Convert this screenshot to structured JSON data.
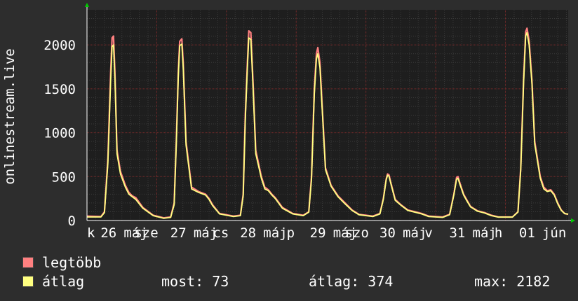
{
  "chart_data": {
    "type": "line",
    "ylabel": "onlinestream.live",
    "ylim": [
      0,
      2400
    ],
    "yticks": [
      0,
      500,
      1000,
      1500,
      2000
    ],
    "xlim": [
      0,
      6.9
    ],
    "xtick_labels": [
      {
        "x": 0.0,
        "label": "k"
      },
      {
        "x": 0.31,
        "label": "26"
      },
      {
        "x": 0.7,
        "label": "máj"
      },
      {
        "x": 0.85,
        "label": "sze"
      },
      {
        "x": 1.31,
        "label": "27"
      },
      {
        "x": 1.7,
        "label": "máj"
      },
      {
        "x": 1.92,
        "label": "cs"
      },
      {
        "x": 2.31,
        "label": "28"
      },
      {
        "x": 2.7,
        "label": "máj"
      },
      {
        "x": 2.92,
        "label": "p"
      },
      {
        "x": 3.31,
        "label": "29"
      },
      {
        "x": 3.7,
        "label": "máj"
      },
      {
        "x": 3.87,
        "label": "szo"
      },
      {
        "x": 4.31,
        "label": "30"
      },
      {
        "x": 4.7,
        "label": "máj"
      },
      {
        "x": 4.9,
        "label": "v"
      },
      {
        "x": 5.31,
        "label": "31"
      },
      {
        "x": 5.7,
        "label": "máj"
      },
      {
        "x": 5.9,
        "label": "h"
      },
      {
        "x": 6.31,
        "label": "01"
      },
      {
        "x": 6.7,
        "label": "jún"
      }
    ],
    "grid": true,
    "series": [
      {
        "name": "legtöbb",
        "color": "#ff8080",
        "values": [
          [
            0.0,
            50
          ],
          [
            0.2,
            45
          ],
          [
            0.25,
            100
          ],
          [
            0.3,
            700
          ],
          [
            0.34,
            1700
          ],
          [
            0.36,
            2080
          ],
          [
            0.38,
            2100
          ],
          [
            0.4,
            1700
          ],
          [
            0.43,
            800
          ],
          [
            0.48,
            560
          ],
          [
            0.55,
            400
          ],
          [
            0.6,
            320
          ],
          [
            0.65,
            280
          ],
          [
            0.7,
            260
          ],
          [
            0.8,
            150
          ],
          [
            0.95,
            60
          ],
          [
            1.1,
            30
          ],
          [
            1.2,
            40
          ],
          [
            1.25,
            200
          ],
          [
            1.28,
            900
          ],
          [
            1.31,
            1700
          ],
          [
            1.33,
            2040
          ],
          [
            1.36,
            2070
          ],
          [
            1.38,
            1800
          ],
          [
            1.42,
            900
          ],
          [
            1.5,
            380
          ],
          [
            1.6,
            330
          ],
          [
            1.7,
            300
          ],
          [
            1.75,
            250
          ],
          [
            1.8,
            180
          ],
          [
            1.9,
            80
          ],
          [
            2.1,
            50
          ],
          [
            2.2,
            60
          ],
          [
            2.24,
            300
          ],
          [
            2.27,
            1200
          ],
          [
            2.3,
            1800
          ],
          [
            2.32,
            2160
          ],
          [
            2.35,
            2140
          ],
          [
            2.38,
            1600
          ],
          [
            2.42,
            800
          ],
          [
            2.5,
            500
          ],
          [
            2.55,
            380
          ],
          [
            2.6,
            350
          ],
          [
            2.65,
            300
          ],
          [
            2.7,
            260
          ],
          [
            2.8,
            150
          ],
          [
            2.95,
            80
          ],
          [
            3.1,
            60
          ],
          [
            3.18,
            100
          ],
          [
            3.22,
            500
          ],
          [
            3.26,
            1500
          ],
          [
            3.29,
            1900
          ],
          [
            3.31,
            1970
          ],
          [
            3.34,
            1800
          ],
          [
            3.38,
            1200
          ],
          [
            3.42,
            600
          ],
          [
            3.5,
            400
          ],
          [
            3.6,
            280
          ],
          [
            3.7,
            200
          ],
          [
            3.8,
            120
          ],
          [
            3.9,
            70
          ],
          [
            4.1,
            50
          ],
          [
            4.2,
            80
          ],
          [
            4.25,
            250
          ],
          [
            4.29,
            470
          ],
          [
            4.31,
            530
          ],
          [
            4.33,
            520
          ],
          [
            4.36,
            420
          ],
          [
            4.42,
            240
          ],
          [
            4.5,
            180
          ],
          [
            4.6,
            120
          ],
          [
            4.7,
            100
          ],
          [
            4.8,
            80
          ],
          [
            4.9,
            50
          ],
          [
            5.1,
            40
          ],
          [
            5.2,
            70
          ],
          [
            5.26,
            300
          ],
          [
            5.3,
            490
          ],
          [
            5.32,
            500
          ],
          [
            5.35,
            420
          ],
          [
            5.4,
            300
          ],
          [
            5.45,
            230
          ],
          [
            5.5,
            160
          ],
          [
            5.6,
            110
          ],
          [
            5.7,
            90
          ],
          [
            5.8,
            60
          ],
          [
            5.9,
            40
          ],
          [
            6.1,
            40
          ],
          [
            6.18,
            100
          ],
          [
            6.22,
            600
          ],
          [
            6.26,
            1600
          ],
          [
            6.29,
            2150
          ],
          [
            6.31,
            2190
          ],
          [
            6.34,
            2050
          ],
          [
            6.38,
            1600
          ],
          [
            6.42,
            900
          ],
          [
            6.5,
            500
          ],
          [
            6.55,
            380
          ],
          [
            6.6,
            340
          ],
          [
            6.65,
            350
          ],
          [
            6.7,
            300
          ],
          [
            6.75,
            200
          ],
          [
            6.8,
            120
          ],
          [
            6.85,
            80
          ],
          [
            6.9,
            70
          ]
        ]
      },
      {
        "name": "átlag",
        "color": "#ffff80",
        "values": [
          [
            0.0,
            40
          ],
          [
            0.2,
            40
          ],
          [
            0.25,
            90
          ],
          [
            0.3,
            650
          ],
          [
            0.34,
            1600
          ],
          [
            0.36,
            1980
          ],
          [
            0.38,
            2000
          ],
          [
            0.4,
            1620
          ],
          [
            0.43,
            760
          ],
          [
            0.48,
            530
          ],
          [
            0.55,
            380
          ],
          [
            0.6,
            300
          ],
          [
            0.65,
            270
          ],
          [
            0.7,
            240
          ],
          [
            0.8,
            140
          ],
          [
            0.95,
            55
          ],
          [
            1.1,
            25
          ],
          [
            1.2,
            35
          ],
          [
            1.25,
            180
          ],
          [
            1.28,
            860
          ],
          [
            1.31,
            1640
          ],
          [
            1.33,
            1990
          ],
          [
            1.36,
            2010
          ],
          [
            1.38,
            1740
          ],
          [
            1.42,
            860
          ],
          [
            1.5,
            360
          ],
          [
            1.6,
            320
          ],
          [
            1.7,
            290
          ],
          [
            1.75,
            240
          ],
          [
            1.8,
            170
          ],
          [
            1.9,
            75
          ],
          [
            2.1,
            45
          ],
          [
            2.2,
            55
          ],
          [
            2.24,
            280
          ],
          [
            2.27,
            1140
          ],
          [
            2.3,
            1740
          ],
          [
            2.32,
            2080
          ],
          [
            2.35,
            2060
          ],
          [
            2.38,
            1540
          ],
          [
            2.42,
            760
          ],
          [
            2.5,
            480
          ],
          [
            2.55,
            360
          ],
          [
            2.6,
            340
          ],
          [
            2.65,
            290
          ],
          [
            2.7,
            250
          ],
          [
            2.8,
            140
          ],
          [
            2.95,
            75
          ],
          [
            3.1,
            55
          ],
          [
            3.18,
            95
          ],
          [
            3.22,
            470
          ],
          [
            3.26,
            1440
          ],
          [
            3.29,
            1840
          ],
          [
            3.31,
            1900
          ],
          [
            3.34,
            1740
          ],
          [
            3.38,
            1160
          ],
          [
            3.42,
            580
          ],
          [
            3.5,
            390
          ],
          [
            3.6,
            270
          ],
          [
            3.7,
            190
          ],
          [
            3.8,
            115
          ],
          [
            3.9,
            65
          ],
          [
            4.1,
            45
          ],
          [
            4.2,
            75
          ],
          [
            4.25,
            240
          ],
          [
            4.29,
            460
          ],
          [
            4.31,
            515
          ],
          [
            4.33,
            505
          ],
          [
            4.36,
            410
          ],
          [
            4.42,
            230
          ],
          [
            4.5,
            175
          ],
          [
            4.6,
            115
          ],
          [
            4.7,
            95
          ],
          [
            4.8,
            75
          ],
          [
            4.9,
            45
          ],
          [
            5.1,
            35
          ],
          [
            5.2,
            65
          ],
          [
            5.26,
            290
          ],
          [
            5.3,
            470
          ],
          [
            5.32,
            480
          ],
          [
            5.35,
            405
          ],
          [
            5.4,
            290
          ],
          [
            5.45,
            220
          ],
          [
            5.5,
            155
          ],
          [
            5.6,
            105
          ],
          [
            5.7,
            85
          ],
          [
            5.8,
            55
          ],
          [
            5.9,
            38
          ],
          [
            6.1,
            38
          ],
          [
            6.18,
            95
          ],
          [
            6.22,
            580
          ],
          [
            6.26,
            1560
          ],
          [
            6.29,
            2100
          ],
          [
            6.31,
            2140
          ],
          [
            6.34,
            2000
          ],
          [
            6.38,
            1560
          ],
          [
            6.42,
            870
          ],
          [
            6.5,
            480
          ],
          [
            6.55,
            360
          ],
          [
            6.6,
            330
          ],
          [
            6.65,
            340
          ],
          [
            6.7,
            290
          ],
          [
            6.75,
            190
          ],
          [
            6.8,
            115
          ],
          [
            6.85,
            78
          ],
          [
            6.9,
            73
          ]
        ]
      }
    ]
  },
  "legend": {
    "items": [
      {
        "label": "legtöbb",
        "color": "#ff8080"
      },
      {
        "label": "átlag",
        "color": "#ffff80"
      }
    ]
  },
  "stats": {
    "most": "most: 73",
    "atlag": "átlag: 374",
    "max": "max: 2182"
  },
  "colors": {
    "background": "#2d2d2d",
    "plot_background": "#1e1e1e",
    "grid_minor": "#3a3a3a",
    "grid_major": "#7a2a2a",
    "axis": "#ffffff",
    "arrow": "#00cc00"
  }
}
